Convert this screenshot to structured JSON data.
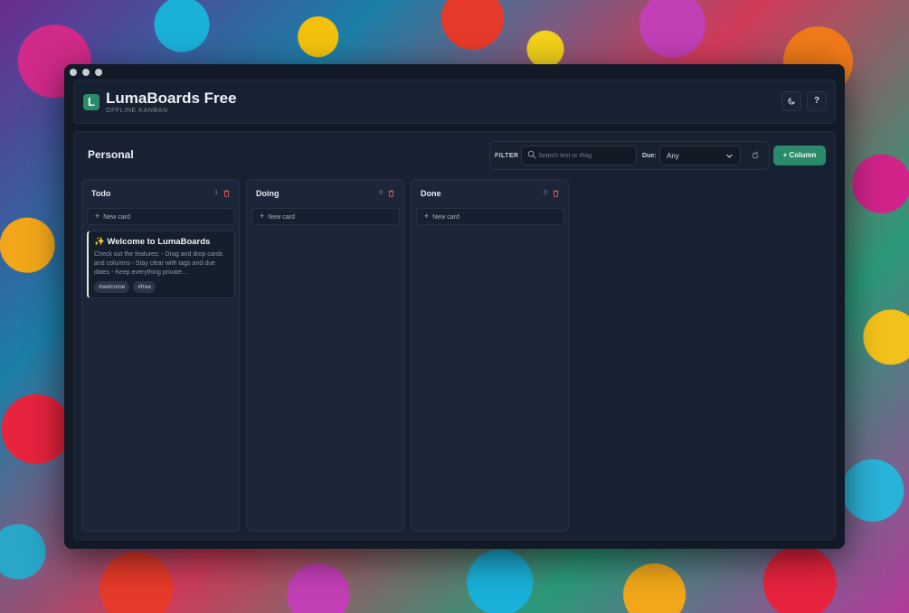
{
  "app": {
    "title": "LumaBoards Free",
    "subtitle": "OFFLINE KANBAN",
    "logo_letter": "L",
    "theme_button_icon": "moon-icon",
    "help_label": "?"
  },
  "board": {
    "title": "Personal",
    "filter": {
      "label": "FILTER",
      "search_placeholder": "Search text or #tag",
      "search_value": "",
      "due_label": "Due:",
      "due_value": "Any"
    },
    "add_column_label": "+ Column"
  },
  "columns": [
    {
      "title": "Todo",
      "count": "1",
      "new_card_label": "New card",
      "cards": [
        {
          "title": "✨ Welcome to LumaBoards",
          "description": "Check out the features: - Drag and drop cards and columns - Stay clear with tags and due dates - Keep everything private…",
          "tags": [
            "#welcome",
            "#free"
          ]
        }
      ]
    },
    {
      "title": "Doing",
      "count": "0",
      "new_card_label": "New card",
      "cards": []
    },
    {
      "title": "Done",
      "count": "0",
      "new_card_label": "New card",
      "cards": []
    }
  ],
  "colors": {
    "accent": "#2b8a6a",
    "danger": "#e0525a",
    "window_bg": "#121a27"
  }
}
